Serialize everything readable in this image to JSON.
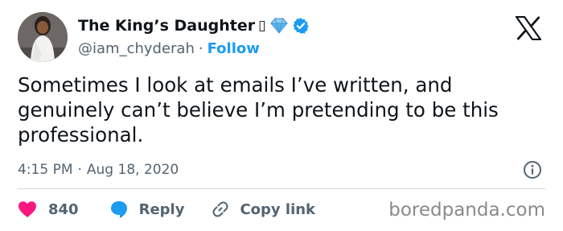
{
  "author": {
    "display_name": "The King’s Daughter",
    "name_glyph": "▯",
    "handle": "@iam_chyderah",
    "separator": "·",
    "follow_label": "Follow"
  },
  "tweet": {
    "text": "Sometimes I look at emails I’ve written, and genuinely can’t believe I’m pretending to be this professional.",
    "time": "4:15 PM",
    "separator": "·",
    "date": "Aug 18, 2020"
  },
  "actions": {
    "like_count": "840",
    "reply_label": "Reply",
    "copy_link_label": "Copy link"
  },
  "watermark": "boredpanda.com",
  "colors": {
    "accent_blue": "#1d9bf0",
    "like_red": "#f91880",
    "secondary_text": "#536471",
    "primary_text": "#0f1419",
    "divider": "#cfd9de"
  },
  "icons": {
    "logo": "x-logo-icon",
    "badge": "diamond-icon",
    "verified": "verified-badge-icon",
    "info": "info-icon",
    "like": "heart-icon",
    "reply": "speech-bubble-icon",
    "copy": "link-icon"
  }
}
